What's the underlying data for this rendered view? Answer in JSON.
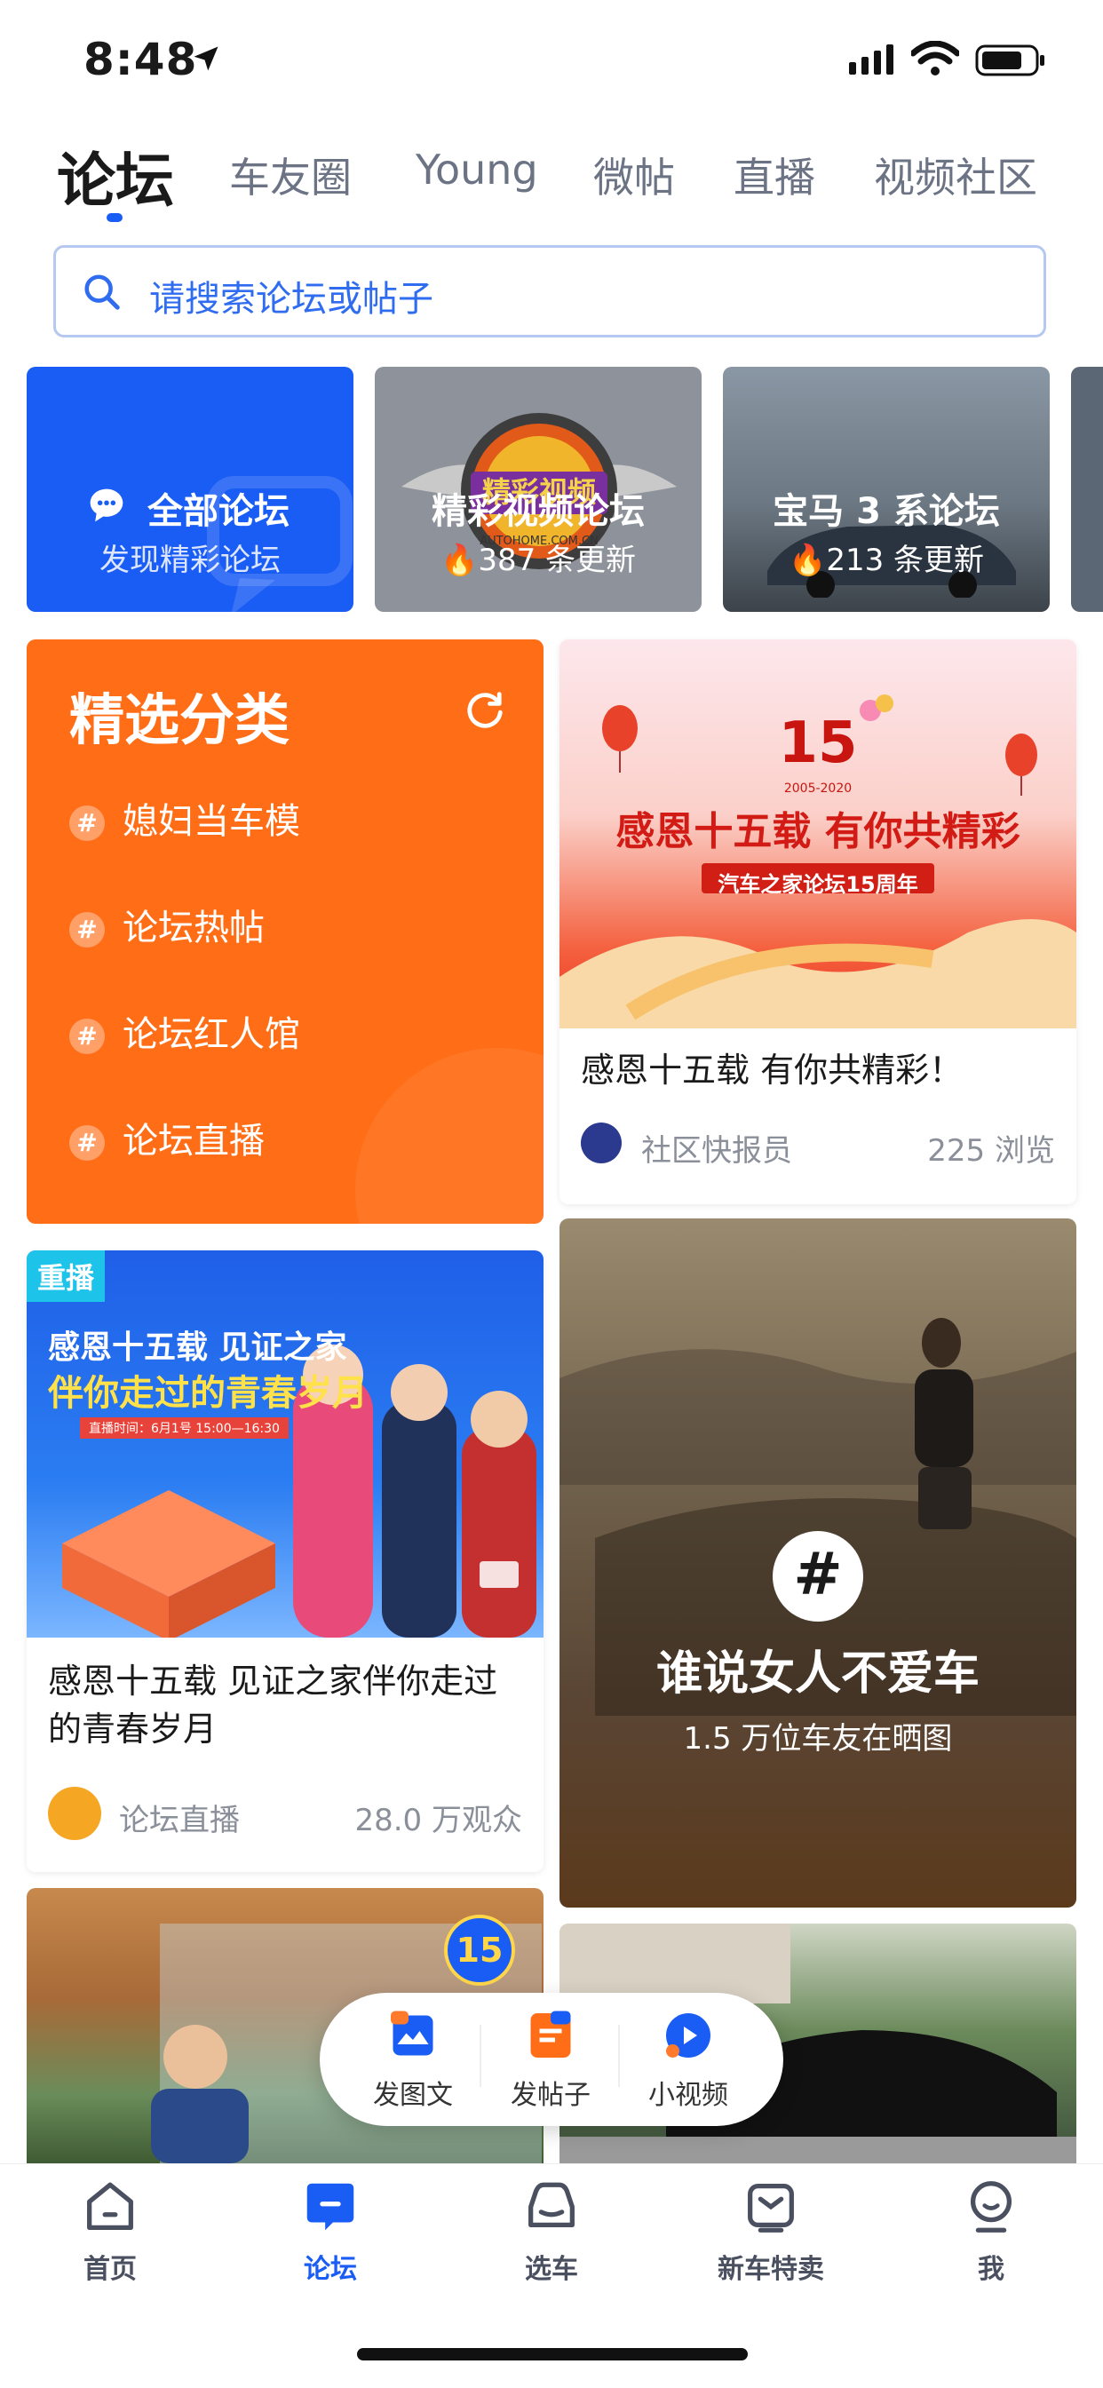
{
  "status_bar": {
    "time": "8:48"
  },
  "tabs": [
    {
      "label": "论坛",
      "active": true
    },
    {
      "label": "车友圈"
    },
    {
      "label": "Young"
    },
    {
      "label": "微帖"
    },
    {
      "label": "直播"
    },
    {
      "label": "视频社区"
    }
  ],
  "search": {
    "placeholder": "请搜索论坛或帖子"
  },
  "forum_cards": [
    {
      "title": "全部论坛",
      "subtitle": "发现精彩论坛",
      "color": "#1a5df5"
    },
    {
      "title": "精彩视频论坛",
      "subtitle": "387 条更新",
      "logo_text": "精彩视频",
      "logo_small": "AUTOHOME.COM.CN"
    },
    {
      "title": "宝马 3 系论坛",
      "subtitle": "213 条更新"
    }
  ],
  "category": {
    "title": "精选分类",
    "items": [
      "媳妇当车模",
      "论坛热帖",
      "论坛红人馆",
      "论坛直播"
    ],
    "color": "#ff6e17"
  },
  "post1": {
    "banner_year": "15",
    "banner_years": "2005-2020",
    "banner_headline": "感恩十五载 有你共精彩",
    "banner_ribbon": "汽车之家论坛15周年",
    "title": "感恩十五载 有你共精彩！",
    "author": "社区快报员",
    "views": "225 浏览"
  },
  "post2": {
    "badge": "重播",
    "banner_line1": "感恩十五载  见证之家",
    "banner_line2": "伴你走过的青春岁月",
    "banner_time": "直播时间：6月1号 15:00—16:30",
    "title": "感恩十五载 见证之家伴你走过的青春岁月",
    "author": "论坛直播",
    "viewers": "28.0 万观众"
  },
  "post3": {
    "title": "谁说女人不爱车",
    "subtitle": "1.5 万位车友在晒图"
  },
  "post4": {
    "badge_number": "15"
  },
  "float_actions": [
    {
      "label": "发图文",
      "icon": "image-text-icon"
    },
    {
      "label": "发帖子",
      "icon": "post-icon"
    },
    {
      "label": "小视频",
      "icon": "video-icon"
    }
  ],
  "bottom_nav": [
    {
      "label": "首页",
      "icon": "home-icon"
    },
    {
      "label": "论坛",
      "icon": "forum-icon",
      "active": true
    },
    {
      "label": "选车",
      "icon": "car-icon"
    },
    {
      "label": "新车特卖",
      "icon": "sale-icon"
    },
    {
      "label": "我",
      "icon": "profile-icon"
    }
  ],
  "colors": {
    "accent": "#1a5df5",
    "orange": "#ff6e17"
  }
}
